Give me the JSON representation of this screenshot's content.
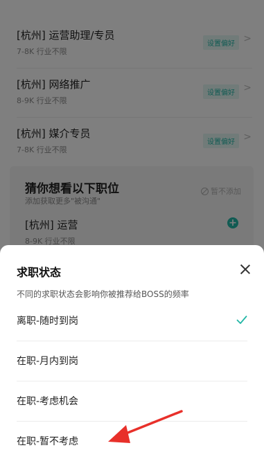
{
  "background": {
    "preferences": [
      {
        "title": "[杭州] 运营助理/专员",
        "meta": "7-8K  行业不限",
        "tag": "设置偏好"
      },
      {
        "title": "[杭州] 网络推广",
        "meta": "8-9K  行业不限",
        "tag": "设置偏好"
      },
      {
        "title": "[杭州] 媒介专员",
        "meta": "7-8K  行业不限",
        "tag": "设置偏好"
      }
    ],
    "guess": {
      "title": "猜你想看以下职位",
      "subtitle": "添加获取更多\"被沟通\"",
      "no_add": "暂不添加",
      "job_title": "[杭州] 运营",
      "job_meta": "8-9K  行业不限"
    }
  },
  "sheet": {
    "title": "求职状态",
    "description": "不同的求职状态会影响你被推荐给BOSS的频率",
    "options": [
      {
        "label": "离职-随时到岗",
        "selected": true
      },
      {
        "label": "在职-月内到岗",
        "selected": false
      },
      {
        "label": "在职-考虑机会",
        "selected": false
      },
      {
        "label": "在职-暂不考虑",
        "selected": false
      }
    ]
  },
  "colors": {
    "accent": "#23b7a6",
    "annotation_arrow": "#e8302a"
  }
}
